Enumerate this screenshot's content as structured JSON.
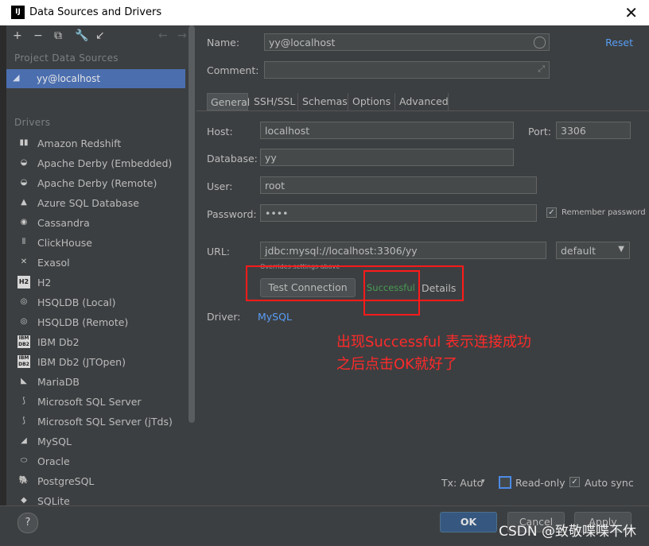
{
  "window": {
    "title": "Data Sources and Drivers",
    "close_glyph": "✕"
  },
  "sidebar": {
    "project_section": "Project Data Sources",
    "data_sources": [
      {
        "label": "yy@localhost"
      }
    ],
    "drivers_section": "Drivers",
    "drivers": [
      {
        "label": "Amazon Redshift",
        "icon": "redshift-icon"
      },
      {
        "label": "Apache Derby (Embedded)",
        "icon": "derby-icon"
      },
      {
        "label": "Apache Derby (Remote)",
        "icon": "derby-icon"
      },
      {
        "label": "Azure SQL Database",
        "icon": "azure-icon"
      },
      {
        "label": "Cassandra",
        "icon": "cassandra-icon"
      },
      {
        "label": "ClickHouse",
        "icon": "clickhouse-icon"
      },
      {
        "label": "Exasol",
        "icon": "exasol-icon"
      },
      {
        "label": "H2",
        "icon": "h2-icon"
      },
      {
        "label": "HSQLDB (Local)",
        "icon": "hsqldb-icon"
      },
      {
        "label": "HSQLDB (Remote)",
        "icon": "hsqldb-icon"
      },
      {
        "label": "IBM Db2",
        "icon": "ibm-db2-icon"
      },
      {
        "label": "IBM Db2 (JTOpen)",
        "icon": "ibm-db2-icon"
      },
      {
        "label": "MariaDB",
        "icon": "mariadb-icon"
      },
      {
        "label": "Microsoft SQL Server",
        "icon": "mssql-icon"
      },
      {
        "label": "Microsoft SQL Server (jTds)",
        "icon": "mssql-icon"
      },
      {
        "label": "MySQL",
        "icon": "mysql-icon"
      },
      {
        "label": "Oracle",
        "icon": "oracle-icon"
      },
      {
        "label": "PostgreSQL",
        "icon": "postgresql-icon"
      },
      {
        "label": "SQLite",
        "icon": "sqlite-icon"
      }
    ]
  },
  "form": {
    "name_label": "Name:",
    "name_value": "yy@localhost",
    "comment_label": "Comment:",
    "comment_value": "",
    "reset_label": "Reset",
    "tabs": [
      {
        "label": "General",
        "active": true
      },
      {
        "label": "SSH/SSL",
        "active": false
      },
      {
        "label": "Schemas",
        "active": false
      },
      {
        "label": "Options",
        "active": false
      },
      {
        "label": "Advanced",
        "active": false
      }
    ],
    "host_label": "Host:",
    "host_value": "localhost",
    "port_label": "Port:",
    "port_value": "3306",
    "database_label": "Database:",
    "database_value": "yy",
    "user_label": "User:",
    "user_value": "root",
    "password_label": "Password:",
    "password_value": "••••",
    "remember_label": "Remember password",
    "url_label": "URL:",
    "url_value": "jdbc:mysql://localhost:3306/yy",
    "url_hint": "Overrides settings above",
    "url_mode": "default",
    "test_button": "Test Connection",
    "status": "Successful",
    "details_link": "Details",
    "driver_label": "Driver:",
    "driver_value": "MySQL",
    "tx_label": "Tx: Auto",
    "readonly_label": "Read-only",
    "autosync_label": "Auto sync"
  },
  "annotation": {
    "line1": "出现Successful 表示连接成功",
    "line2": "之后点击OK就好了"
  },
  "footer": {
    "ok": "OK",
    "cancel": "Cancel",
    "apply": "Apply",
    "help": "?",
    "watermark": "CSDN @致敬喋喋不休"
  },
  "colors": {
    "accent": "#4b6eaf",
    "success": "#499c54",
    "link": "#589df6",
    "annotation": "#ff1a1a"
  }
}
